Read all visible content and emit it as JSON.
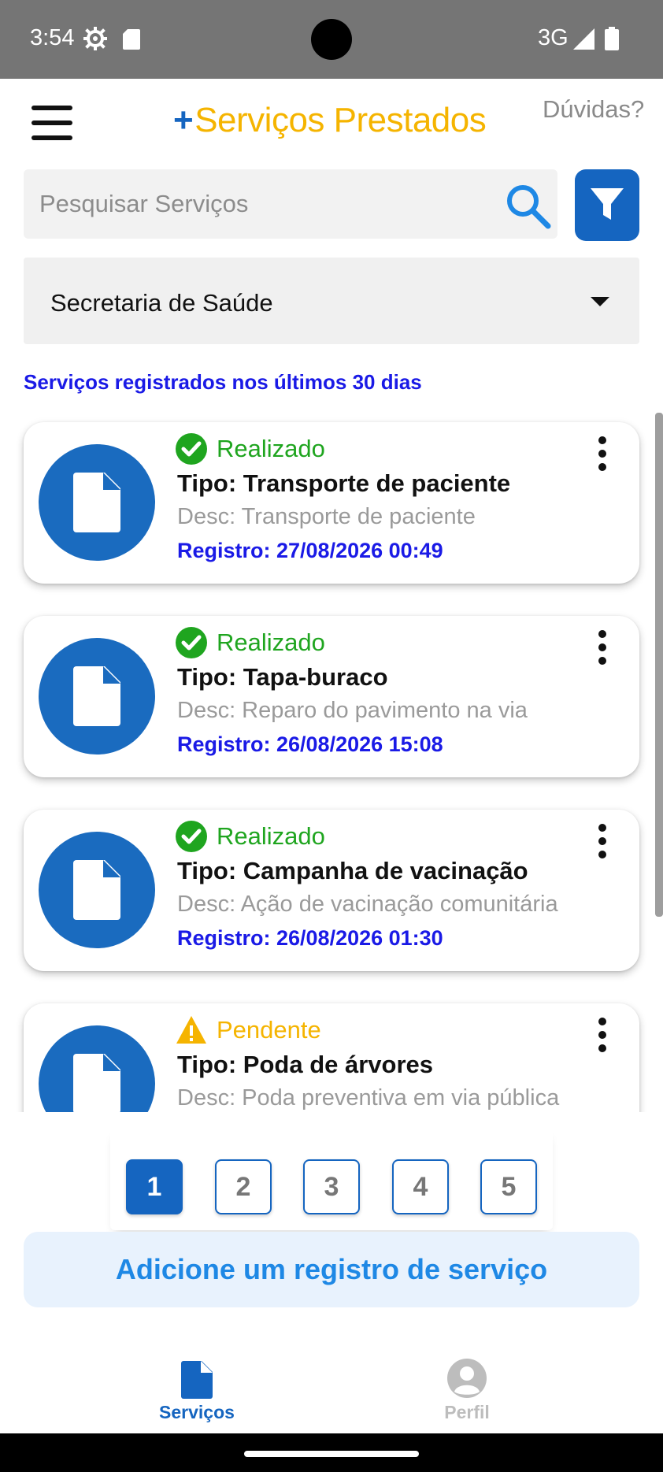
{
  "status_bar": {
    "time": "3:54",
    "network": "3G"
  },
  "header": {
    "title_plus": "+",
    "title": "Serviços Prestados",
    "help_label": "Dúvidas?"
  },
  "search": {
    "placeholder": "Pesquisar Serviços",
    "value": ""
  },
  "department_select": {
    "selected": "Secretaria de Saúde"
  },
  "section_label": "Serviços registrados nos últimos 30 dias",
  "services": [
    {
      "status": "Realizado",
      "status_kind": "done",
      "type": "Tipo: Transporte de paciente",
      "desc": "Desc: Transporte de paciente",
      "date": "Registro: 27/08/2026 00:49"
    },
    {
      "status": "Realizado",
      "status_kind": "done",
      "type": "Tipo: Tapa-buraco",
      "desc": "Desc: Reparo do pavimento na via",
      "date": "Registro: 26/08/2026 15:08"
    },
    {
      "status": "Realizado",
      "status_kind": "done",
      "type": "Tipo: Campanha de vacinação",
      "desc": "Desc: Ação de vacinação comunitária",
      "date": "Registro: 26/08/2026 01:30"
    },
    {
      "status": "Pendente",
      "status_kind": "pending",
      "type": "Tipo: Poda de árvores",
      "desc": "Desc: Poda preventiva em via pública",
      "date": ""
    }
  ],
  "pagination": {
    "pages": [
      "1",
      "2",
      "3",
      "4",
      "5"
    ],
    "current": "1"
  },
  "add_button_label": "Adicione um registro de serviço",
  "bottom_nav": {
    "services_label": "Serviços",
    "profile_label": "Perfil"
  },
  "colors": {
    "brand_blue": "#1565c0",
    "title_yellow": "#f5b400",
    "done_green": "#1fa51f",
    "pending_yellow": "#f5b400",
    "date_blue": "#1a1ae6"
  },
  "icons": {
    "menu": "hamburger-icon",
    "search": "search-icon",
    "filter": "filter-icon",
    "dropdown": "caret-down-icon",
    "card": "document-icon",
    "done": "check-circle-icon",
    "pending": "warning-icon",
    "more": "more-vertical-icon",
    "profile": "user-icon"
  }
}
